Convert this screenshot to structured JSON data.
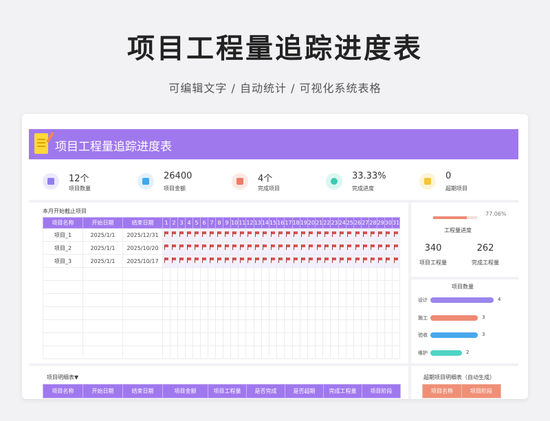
{
  "hero": {
    "title": "项目工程量追踪进度表",
    "subtitle": "可编辑文字 / 自动统计 / 可视化系统表格"
  },
  "banner": {
    "title": "项目工程量追踪进度表",
    "icon": "notepad-icon"
  },
  "stats": [
    {
      "value": "12个",
      "label": "项目数量",
      "icon": "layers-icon",
      "color": "#8f7ef0"
    },
    {
      "value": "26400",
      "label": "项目金额",
      "icon": "grid-icon",
      "color": "#3ea8ee"
    },
    {
      "value": "4个",
      "label": "完成项目",
      "icon": "clipboard-icon",
      "color": "#ee7a6a"
    },
    {
      "value": "33.33%",
      "label": "完成进度",
      "icon": "clock-icon",
      "color": "#3dc9b4"
    },
    {
      "value": "0",
      "label": "超期项目",
      "icon": "document-icon",
      "color": "#f4c538"
    }
  ],
  "gantt": {
    "caption": "本月开始截止项目",
    "headers": [
      "项目名称",
      "开始日期",
      "结束日期"
    ],
    "days": [
      "1",
      "2",
      "3",
      "4",
      "5",
      "6",
      "7",
      "8",
      "9",
      "10",
      "11",
      "12",
      "13",
      "14",
      "15",
      "16",
      "17",
      "18",
      "19",
      "20",
      "21",
      "22",
      "23",
      "24",
      "25",
      "26",
      "27",
      "28",
      "29",
      "30",
      "31"
    ],
    "rows": [
      {
        "name": "项目_1",
        "start": "2025/1/1",
        "end": "2025/12/31"
      },
      {
        "name": "项目_2",
        "start": "2025/1/1",
        "end": "2025/10/20"
      },
      {
        "name": "项目_3",
        "start": "2025/1/1",
        "end": "2025/10/17"
      }
    ],
    "flag_color": "#d9534f"
  },
  "progress": {
    "percent_text": "77.06%",
    "fraction": 0.7706,
    "label": "工程量进度",
    "total_value": "340",
    "total_label": "项目工程量",
    "done_value": "262",
    "done_label": "完成工程量"
  },
  "stage_chart": {
    "title": "项目数量",
    "items": [
      {
        "label": "设计",
        "value": 4,
        "value_text": "4",
        "color": "#9b86ee"
      },
      {
        "label": "施工",
        "value": 3,
        "value_text": "3",
        "color": "#ee8a74"
      },
      {
        "label": "验收",
        "value": 3,
        "value_text": "3",
        "color": "#4aa8ee"
      },
      {
        "label": "维护",
        "value": 2,
        "value_text": "2",
        "color": "#4fd3c3"
      }
    ],
    "max": 4
  },
  "detail": {
    "caption": "项目明细表▼",
    "headers": [
      "项目名称",
      "开始日期",
      "结束日期",
      "项目金额",
      "项目工程量",
      "是否完成",
      "是否超期",
      "完成工程量",
      "项目阶段"
    ]
  },
  "overdue": {
    "caption": "超期项目明细表（自动生成）",
    "headers": [
      "项目名称",
      "项目阶段"
    ]
  }
}
